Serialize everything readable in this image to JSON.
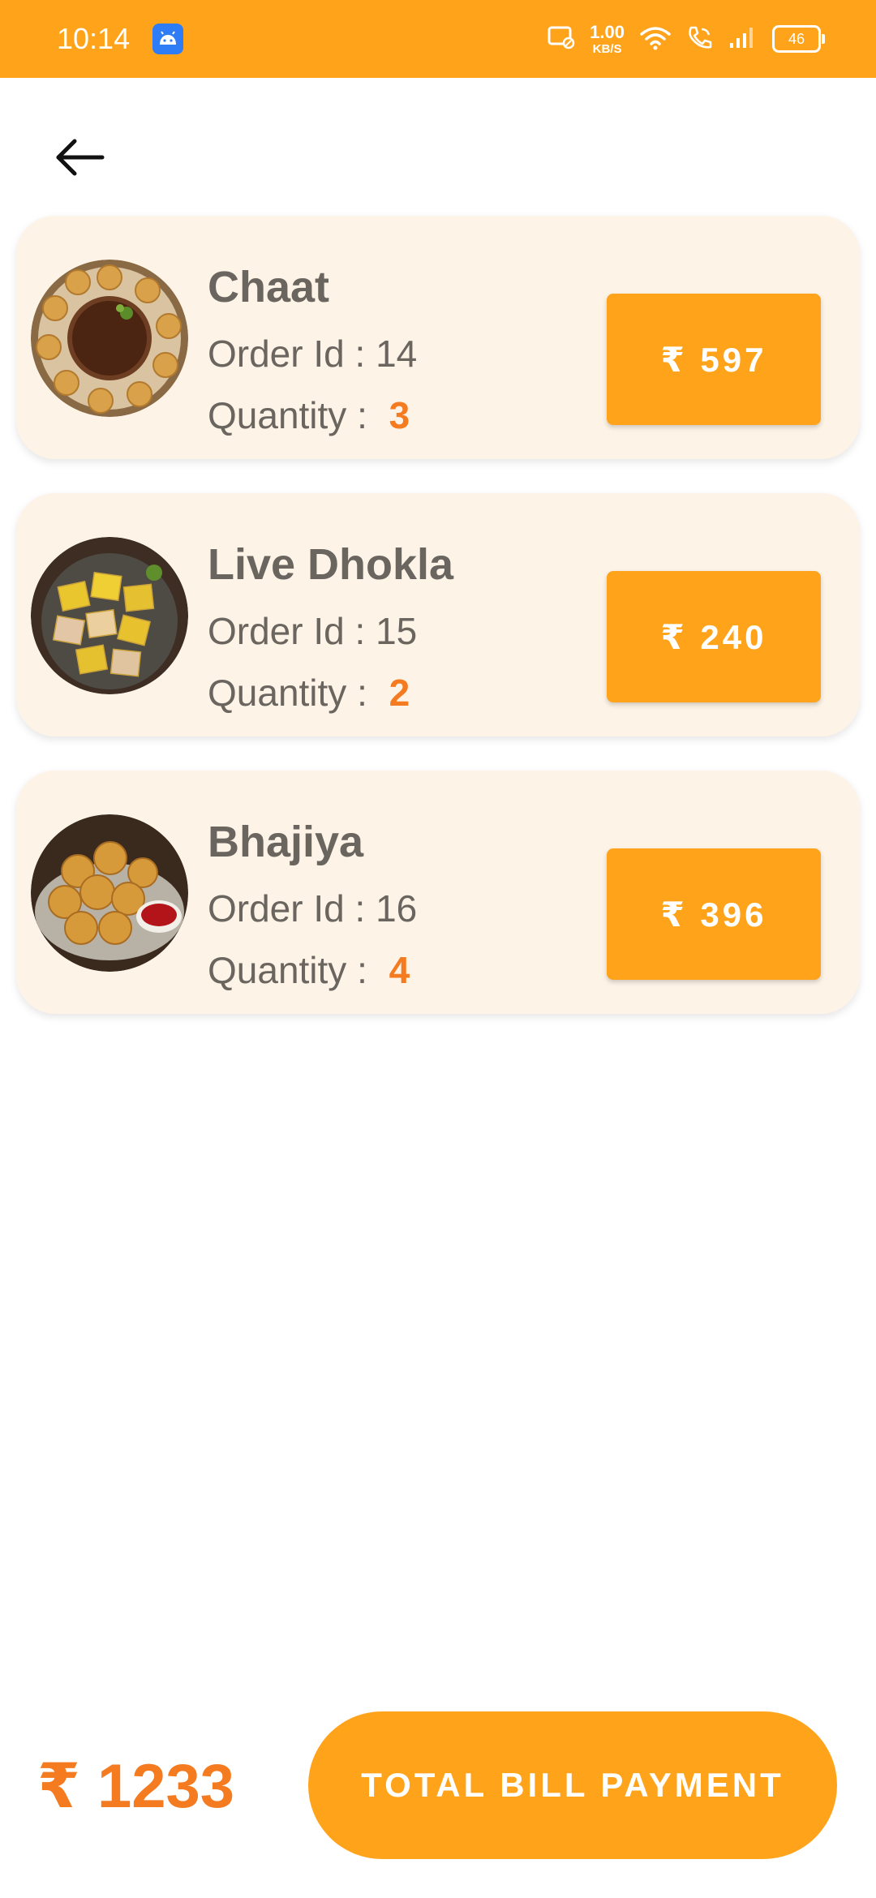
{
  "status_bar": {
    "time": "10:14",
    "network_speed_value": "1.00",
    "network_speed_unit": "KB/S",
    "battery_level": "46",
    "icons": [
      "android-app-icon",
      "screen-cast-icon",
      "wifi-icon",
      "wifi-calling-icon",
      "signal-icon",
      "battery-icon"
    ]
  },
  "header": {
    "back_icon": "arrow-left-icon"
  },
  "orders": [
    {
      "name": "Chaat",
      "order_id_text": "Order Id : 14",
      "quantity_label": "Quantity :",
      "quantity": "3",
      "price": "₹ 597",
      "image": "chaat-image"
    },
    {
      "name": "Live Dhokla",
      "order_id_text": "Order Id : 15",
      "quantity_label": "Quantity :",
      "quantity": "2",
      "price": "₹ 240",
      "image": "dhokla-image"
    },
    {
      "name": "Bhajiya",
      "order_id_text": "Order Id : 16",
      "quantity_label": "Quantity :",
      "quantity": "4",
      "price": "₹ 396",
      "image": "bhajiya-image"
    }
  ],
  "footer": {
    "total": "₹ 1233",
    "pay_label": "TOTAL BILL PAYMENT"
  },
  "colors": {
    "accent": "#FFA31A",
    "highlight": "#F47B20",
    "card_background": "#FDF3E6",
    "text": "#6B6560"
  }
}
